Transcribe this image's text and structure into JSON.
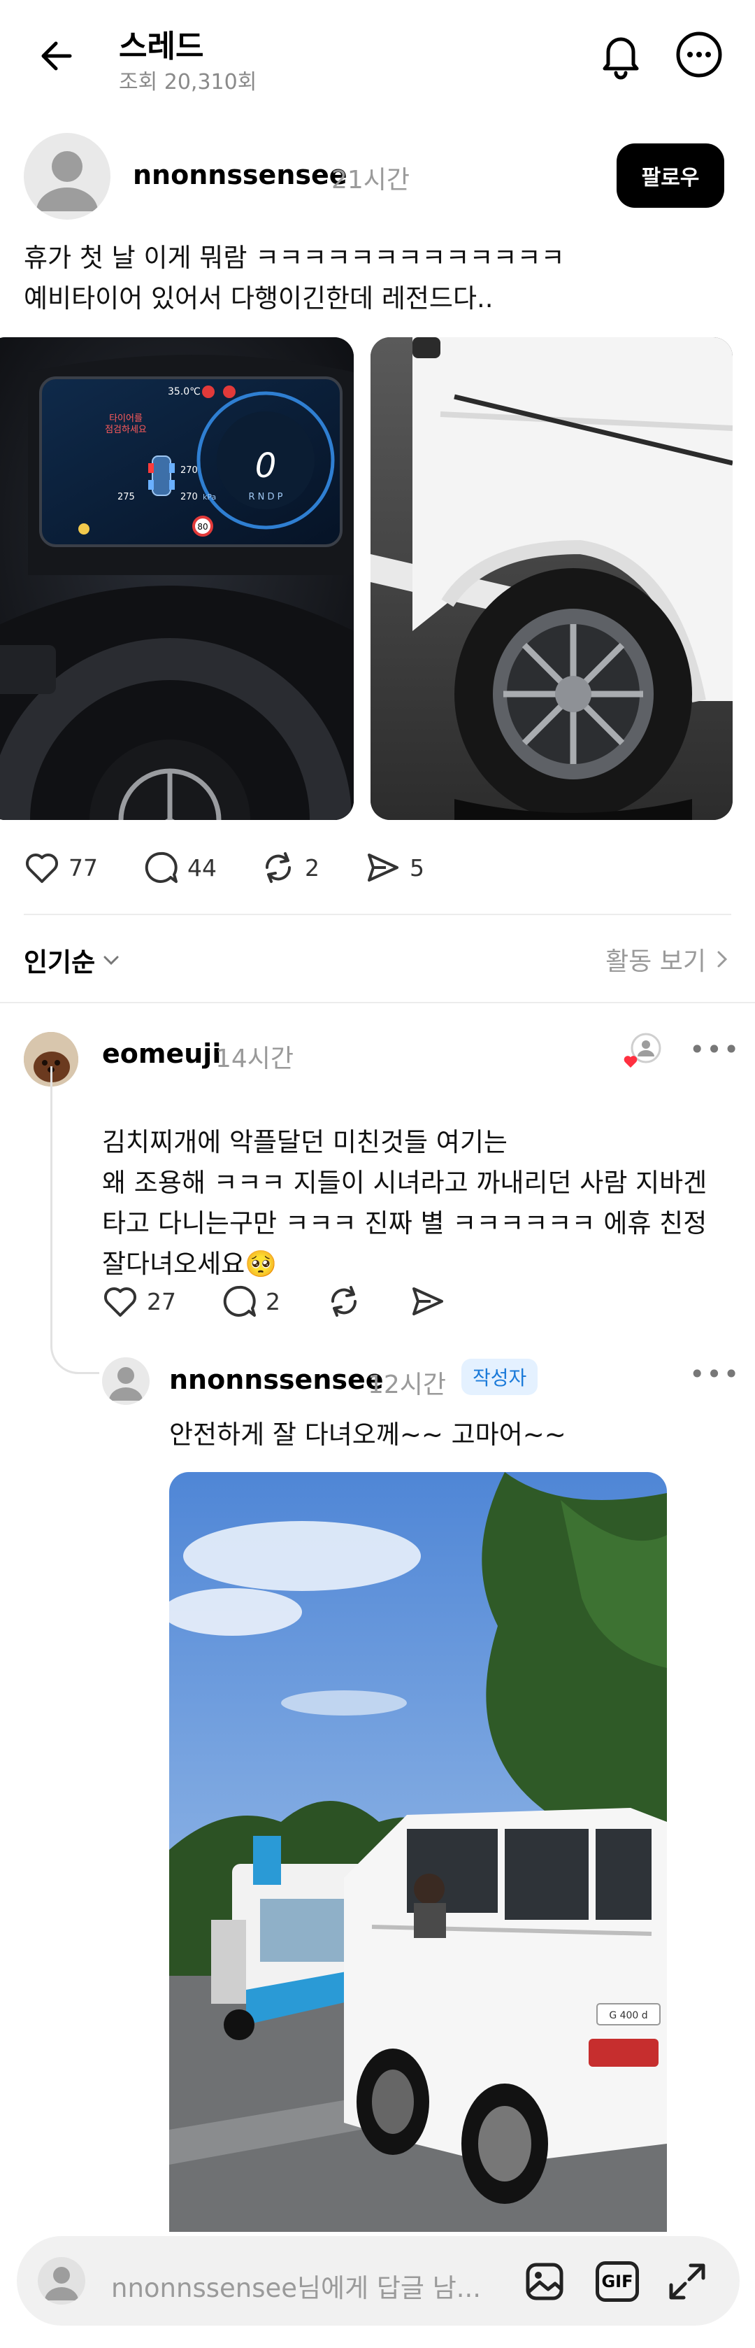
{
  "header": {
    "title": "스레드",
    "views": "조회 20,310회"
  },
  "post": {
    "username": "nnonnssensee",
    "time": "21시간",
    "follow_label": "팔로우",
    "text": "휴가 첫 날 이게 뭐람 ㅋㅋㅋㅋㅋㅋㅋㅋㅋㅋㅋㅋㅋ\n예비타이어 있어서 다행이긴한데 레전드다..",
    "dash": {
      "temp": "35.0℃",
      "warning": "타이어를\n점검하세요",
      "tire_fr": "270",
      "tire_rl": "275",
      "tire_rr": "270",
      "unit": "kPa",
      "gear_letters": "R N D P",
      "speed_limit": "80"
    },
    "actions": {
      "likes": "77",
      "comments": "44",
      "reposts": "2",
      "shares": "5"
    }
  },
  "sort": {
    "label": "인기순",
    "activity_label": "활동 보기"
  },
  "comment": {
    "username": "eomeuji",
    "time": "14시간",
    "text": "김치찌개에 악플달던 미친것들 여기는\n왜 조용해 ㅋㅋㅋ 지들이 시녀라고 까내리던 사람 지바겐\n타고 다니는구만 ㅋㅋㅋ 진짜 별 ㅋㅋㅋㅋㅋㅋ 에휴 친정\n잘다녀오세요",
    "emoji": "🥺",
    "actions": {
      "likes": "27",
      "comments": "2"
    }
  },
  "reply": {
    "username": "nnonnssensee",
    "time": "12시간",
    "badge": "작성자",
    "text": "안전하게 잘 다녀오께~~ 고마어~~",
    "plate_text": "G 400 d"
  },
  "reply_bar": {
    "placeholder": "nnonnssensee님에게 답글 남...",
    "gif_label": "GIF"
  },
  "colors": {
    "accent_blue": "#1a7ad9",
    "like_red": "#ff3040"
  }
}
